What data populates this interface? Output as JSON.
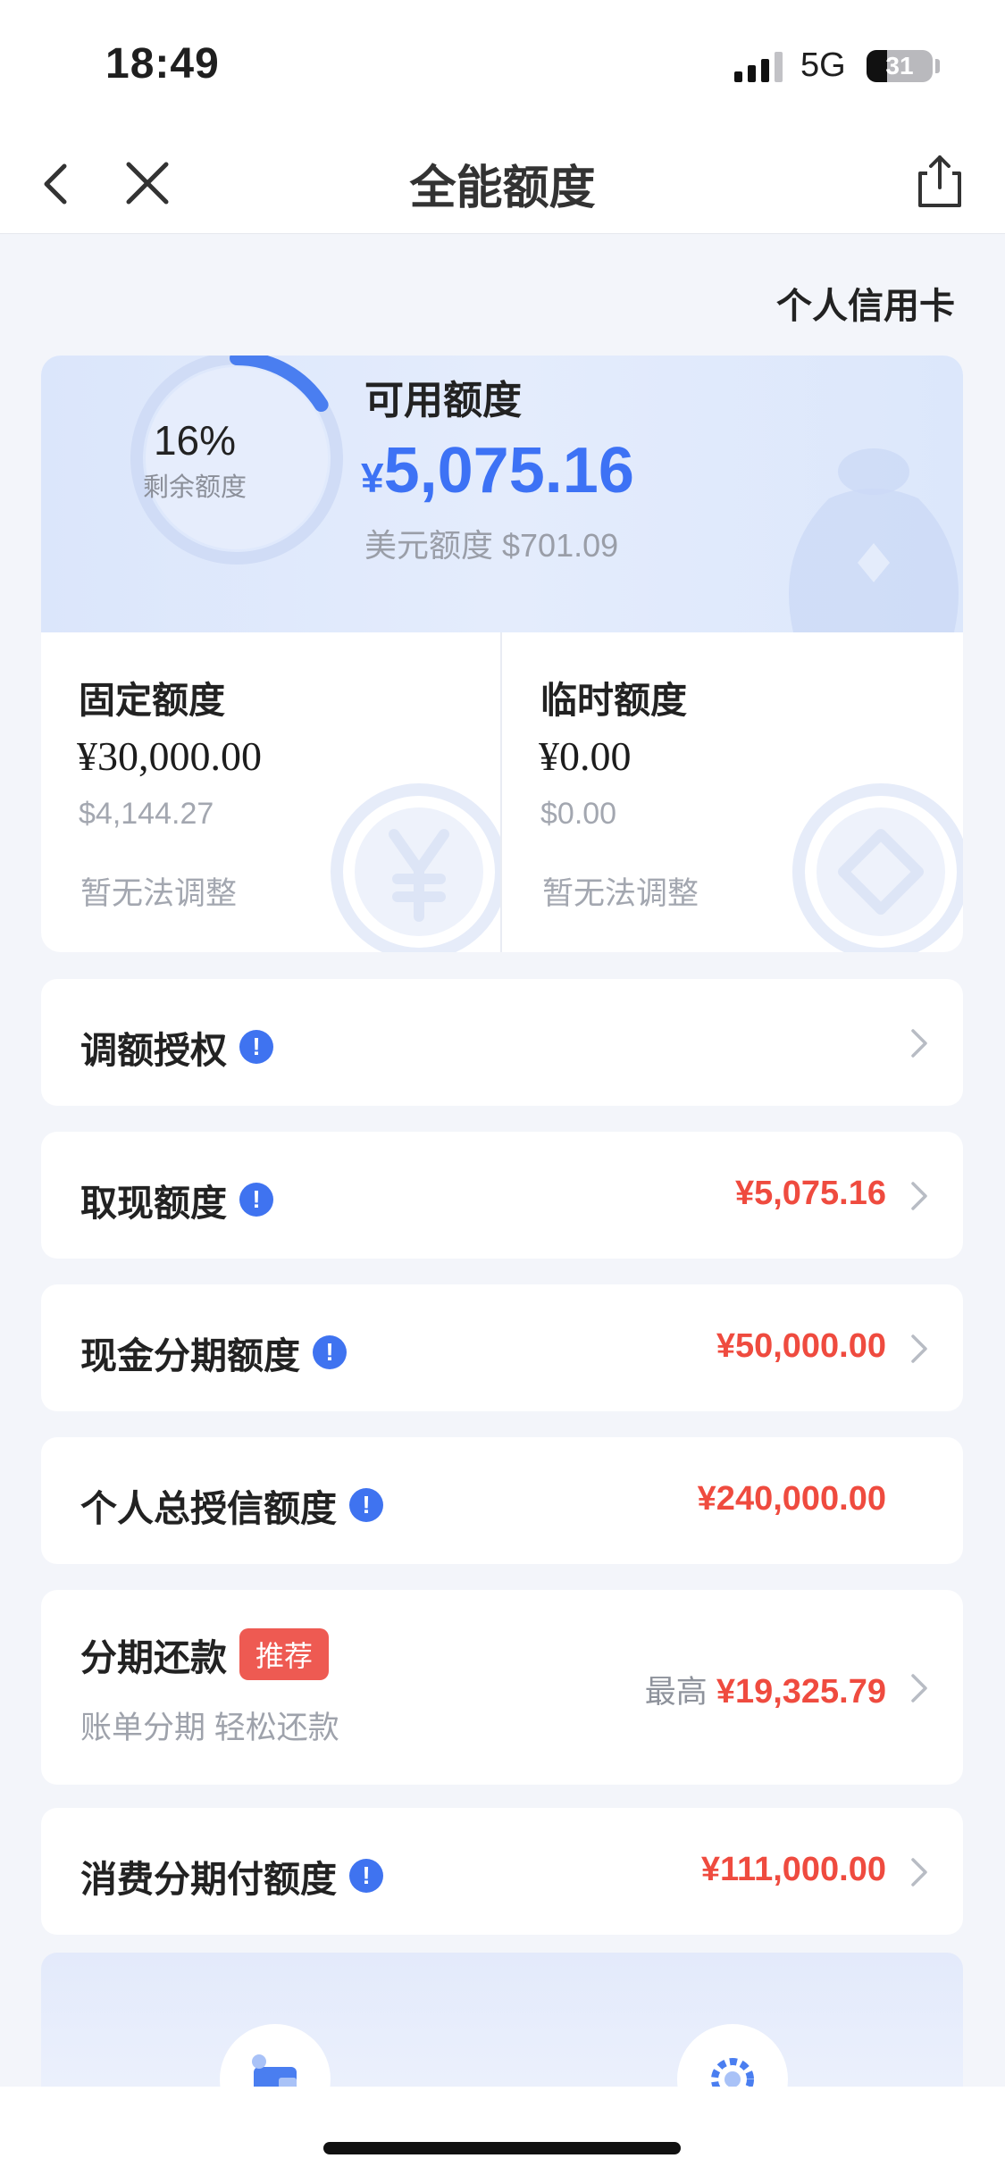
{
  "status_bar": {
    "time": "18:49",
    "network": "5G",
    "battery": "31",
    "battery_percent": 31
  },
  "nav": {
    "title": "全能额度"
  },
  "card_type": "个人信用卡",
  "summary": {
    "remaining_percent": 16,
    "remaining_percent_text": "16%",
    "remaining_label": "剩余额度",
    "available_label": "可用额度",
    "available_symbol": "¥",
    "available_amount": "5,075.16",
    "usd_line": "美元额度 $701.09"
  },
  "fixed_quota": {
    "title": "固定额度",
    "amount": "¥30,000.00",
    "usd": "$4,144.27",
    "note": "暂无法调整"
  },
  "temp_quota": {
    "title": "临时额度",
    "amount": "¥0.00",
    "usd": "$0.00",
    "note": "暂无法调整"
  },
  "rows": [
    {
      "label": "调额授权",
      "value": ""
    },
    {
      "label": "取现额度",
      "value": "¥5,075.16"
    },
    {
      "label": "现金分期额度",
      "value": "¥50,000.00"
    },
    {
      "label": "个人总授信额度",
      "value": "¥240,000.00"
    },
    {
      "label": "分期还款",
      "badge": "推荐",
      "sub": "账单分期 轻松还款",
      "prefix": "最高",
      "value": "¥19,325.79"
    },
    {
      "label": "消费分期付额度",
      "value": "¥111,000.00"
    }
  ],
  "info_glyph": "!",
  "colors": {
    "accent_blue": "#3d72f5",
    "amount_red": "#ef4b3f",
    "badge_red": "#ee5a52"
  },
  "icons": [
    "back-icon",
    "close-icon",
    "share-icon",
    "info-icon",
    "chevron-right-icon",
    "wallet-icon",
    "settings-icon"
  ]
}
